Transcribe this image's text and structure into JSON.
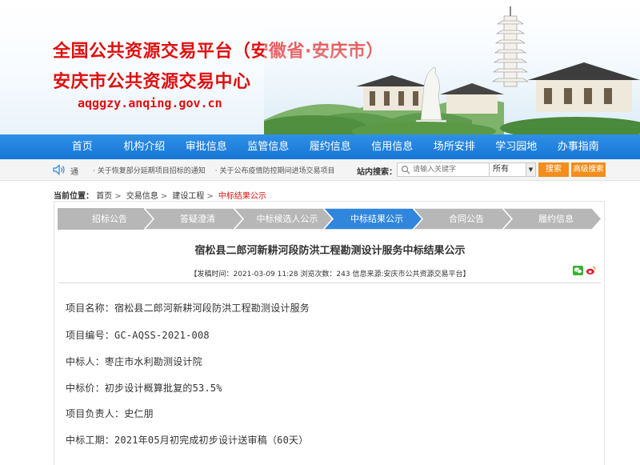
{
  "header": {
    "title_line1": "全国公共资源交易平台（安徽省·安庆市）",
    "title_line2": "安庆市公共资源交易中心",
    "site_url": "aqggzy.anqing.gov.cn"
  },
  "nav": {
    "items": [
      "首页",
      "机构介绍",
      "审批信息",
      "监管信息",
      "履约信息",
      "信用信息",
      "场所安排",
      "学习园地",
      "办事指南"
    ]
  },
  "notice": {
    "label": "通",
    "items": [
      "· 关于恢复部分延期项目招标的通知",
      "· 关于公布疫情防控期间进场交易项目"
    ],
    "search_label": "站内搜索：",
    "search_placeholder": "请输入关键字",
    "scope_selected": "所有",
    "search_button": "搜索",
    "advanced_button": "高级搜索"
  },
  "breadcrumb": {
    "label": "当前位置：",
    "items": [
      "首页",
      "交易信息",
      "建设工程"
    ],
    "current": "中标结果公示"
  },
  "steps": {
    "items": [
      "招标公告",
      "答疑澄清",
      "中标候选人公示",
      "中标结果公示",
      "合同公告",
      "履约信息"
    ],
    "active_index": 3
  },
  "article": {
    "title": "宿松县二郎河新耕河段防洪工程勘测设计服务中标结果公示",
    "meta": "【发稿时间：2021-03-09 11:28    浏览次数：243    信息来源:安庆市公共资源交易平台】",
    "fields": [
      "项目名称：宿松县二郎河新耕河段防洪工程勘测设计服务",
      "项目编号：GC-AQSS-2021-008",
      "中标人：枣庄市水利勘测设计院",
      "中标价：初步设计概算批复的53.5%",
      "项目负责人：史仁朋",
      "中标工期：2021年05月初完成初步设计送审稿（60天）"
    ]
  },
  "colors": {
    "title_red": "#e00f0f",
    "nav_blue": "#1676d6",
    "step_gray": "#b7b7b7",
    "step_active": "#2f86dc",
    "button_orange": "#f28e1c"
  }
}
